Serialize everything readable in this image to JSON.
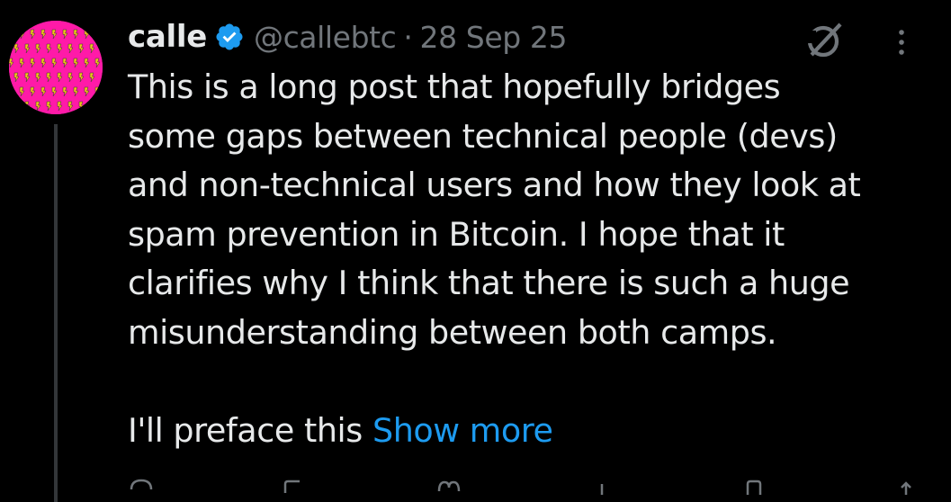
{
  "author": {
    "name": "calle",
    "handle": "@callebtc",
    "separator": "·",
    "date": "28 Sep 25"
  },
  "icons": {
    "verified": "verified-badge-icon",
    "grok": "grok-icon",
    "more": "more-vertical-icon",
    "accent": "#1d9bf0",
    "avatar_bg": "#ff1aa8"
  },
  "post": {
    "lines": [
      "This is a long post that hopefully bridges",
      "some gaps between technical people (devs)",
      "and non-technical users and how they look at",
      "spam prevention in Bitcoin. I hope that it",
      "clarifies why I think that there is such a huge",
      "misunderstanding between both camps."
    ],
    "last_line_prefix": "I'll preface this ",
    "show_more": "Show more"
  }
}
